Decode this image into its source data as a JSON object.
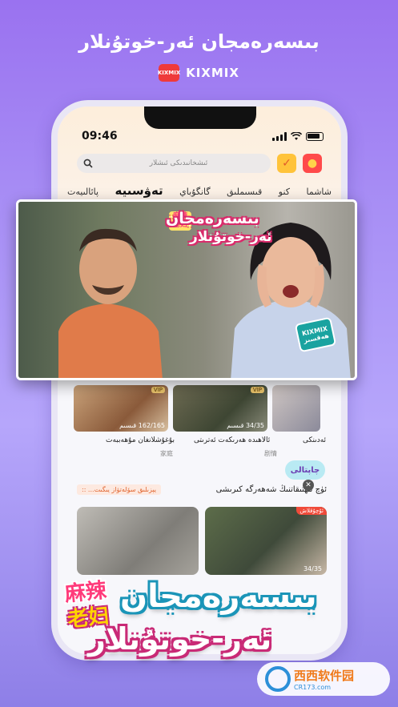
{
  "promo": {
    "title": "بىسەرەمجان ئەر-خوتۇنلار",
    "brand_logo_text": "KIXMIX",
    "brand_name": "KIXMIX"
  },
  "status_bar": {
    "time": "09:46"
  },
  "search": {
    "placeholder": "ئىشخانىدىكى ئىشلار"
  },
  "tabs": [
    {
      "label": "شاشما",
      "active": false
    },
    {
      "label": "كنو",
      "active": false
    },
    {
      "label": "قىسىملىق",
      "active": false
    },
    {
      "label": "گانگۇباي",
      "active": false
    },
    {
      "label": "تەۋسىيە",
      "active": true
    },
    {
      "label": "پائالىيەت",
      "active": false
    }
  ],
  "cards": [
    {
      "badge": "",
      "episodes": "",
      "title": "ئەدىنكى",
      "subtitle": ""
    },
    {
      "badge": "VIP",
      "episodes": "34/35 قىسىم",
      "title": "ئالاھىدە ھەرىكەت ئەترىتى",
      "subtitle": "剧情"
    },
    {
      "badge": "VIP",
      "episodes": "162/165 قىسىم",
      "title": "بۇغۇشلانغان مۇھەببەت",
      "subtitle": "家庭"
    }
  ],
  "section": {
    "left_label": "يېزىلىق سۆلەتۋاز يىگىت... ::",
    "right_label": "ئۈچ ئىھتىقاتنىڭ شەھەرگە كىرىشى",
    "float_pill": "چاپتالى"
  },
  "lower_cards": [
    {
      "tag": "",
      "episodes": ""
    },
    {
      "tag": "ئۇچۇقلاش",
      "episodes": "34/35"
    }
  ],
  "overlay": {
    "title_line1": "بىسەرەمجان",
    "title_line2": "ئەر-خوتۇنلار",
    "cn_label": "麻辣老妇",
    "badge_top": "KIXMIX",
    "badge_bottom": "ھەقسىز"
  },
  "bottom": {
    "line1": "بىسەرەمجان",
    "line2": "ئەر-خوتۇنلار",
    "cn_top": "麻辣",
    "cn_bottom": "老妇"
  },
  "watermark": {
    "text": "西西软件园",
    "url": "CR173.com"
  }
}
